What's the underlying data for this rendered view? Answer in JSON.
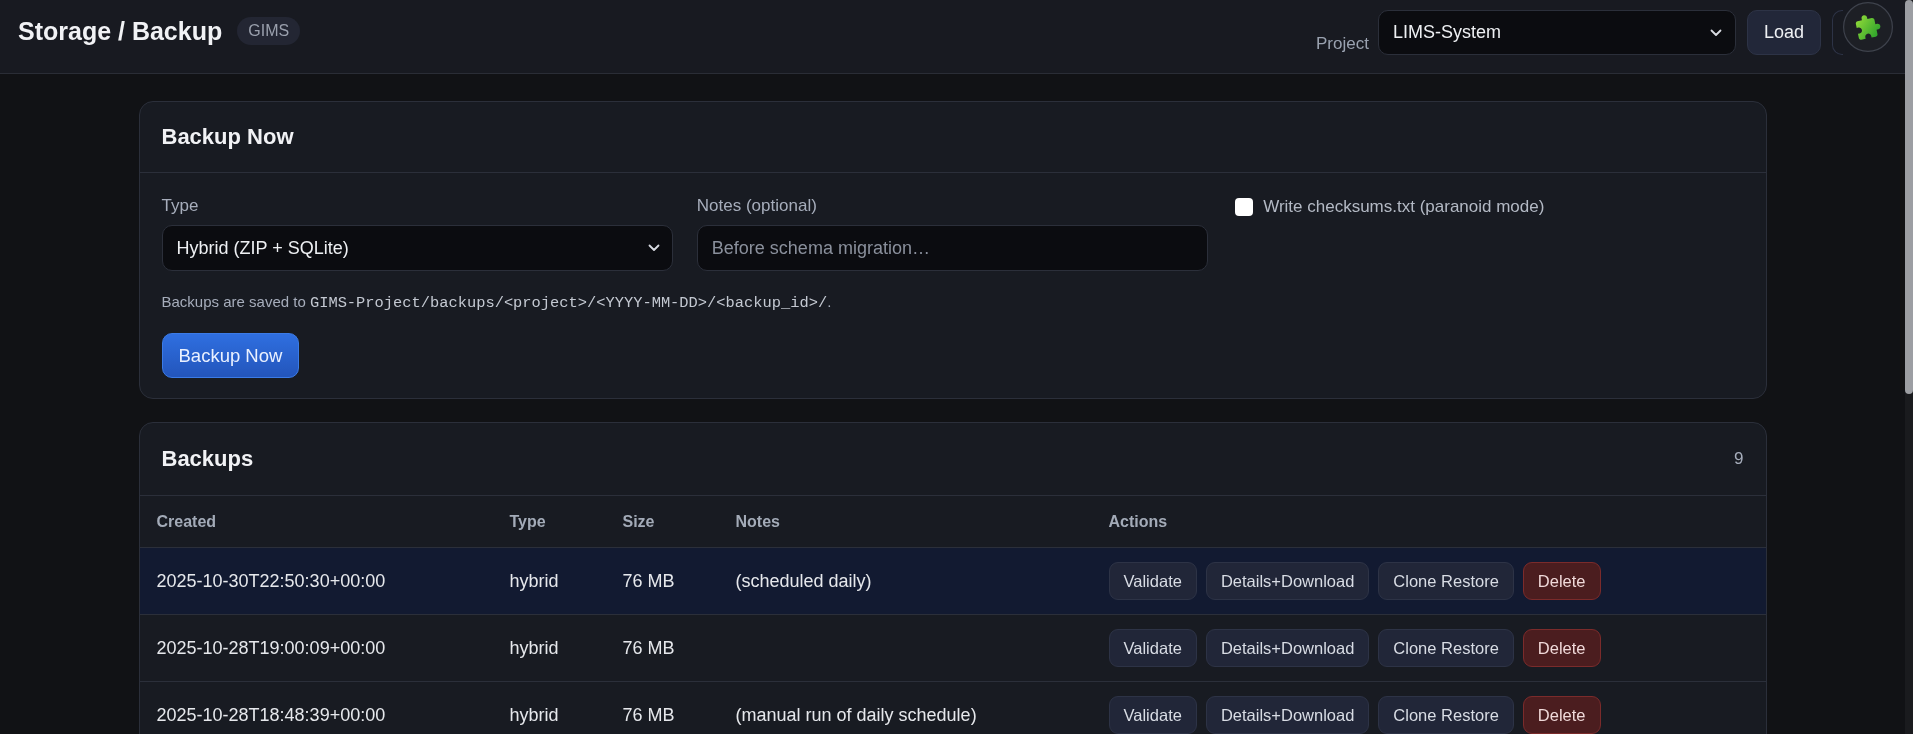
{
  "header": {
    "title": "Storage / Backup",
    "badge": "GIMS",
    "project_label": "Project",
    "project_value": "LIMS-System",
    "load_button": "Load"
  },
  "backup_now": {
    "title": "Backup Now",
    "type_label": "Type",
    "type_value": "Hybrid (ZIP + SQLite)",
    "notes_label": "Notes (optional)",
    "notes_placeholder": "Before schema migration…",
    "checksums": {
      "label": "Write checksums.txt (paranoid mode)",
      "checked": false
    },
    "hint": {
      "text": "Backups are saved to",
      "path": "GIMS-Project/backups/<project>/<YYYY-MM-DD>/<backup_id>/",
      "end": "."
    },
    "button": "Backup Now"
  },
  "backups": {
    "title": "Backups",
    "count": "9",
    "columns": [
      "Created",
      "Type",
      "Size",
      "Notes",
      "Actions"
    ],
    "rows": [
      {
        "selected": true,
        "created": "2025-10-30T22:50:30+00:00",
        "type": "hybrid",
        "size": "76 MB",
        "notes": "(scheduled daily)",
        "actions": [
          {
            "label": "Validate",
            "kind": "default"
          },
          {
            "label": "Details+Download",
            "kind": "default"
          },
          {
            "label": "Clone Restore",
            "kind": "default"
          },
          {
            "label": "Delete",
            "kind": "danger"
          }
        ]
      },
      {
        "selected": false,
        "created": "2025-10-28T19:00:09+00:00",
        "type": "hybrid",
        "size": "76 MB",
        "actions": [
          {
            "label": "Validate",
            "kind": "default"
          },
          {
            "label": "Details+Download",
            "kind": "default"
          },
          {
            "label": "Clone Restore",
            "kind": "default"
          },
          {
            "label": "Delete",
            "kind": "danger"
          }
        ]
      },
      {
        "selected": false,
        "created": "2025-10-28T18:48:39+00:00",
        "type": "hybrid",
        "size": "76 MB",
        "notes": "(manual run of daily schedule)",
        "actions": [
          {
            "label": "Validate",
            "kind": "default"
          },
          {
            "label": "Details+Download",
            "kind": "default"
          },
          {
            "label": "Clone Restore",
            "kind": "default"
          },
          {
            "label": "Delete",
            "kind": "danger"
          }
        ]
      }
    ]
  }
}
